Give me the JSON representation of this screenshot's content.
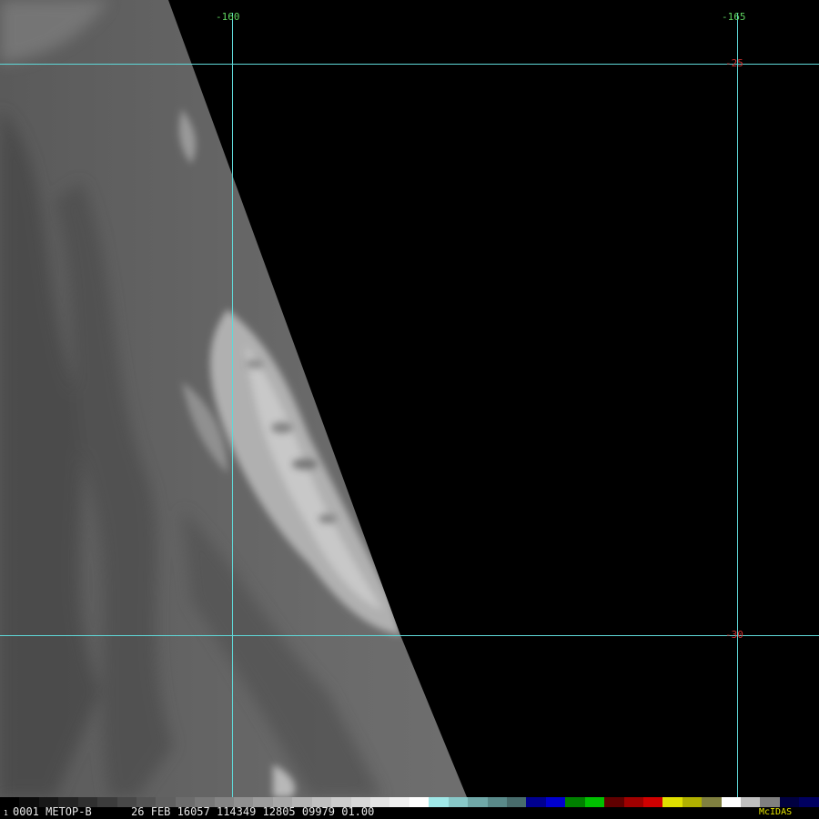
{
  "colors": {
    "background": "#000000",
    "gridline": "#5fd8d8",
    "lon_label": "#5ed15e",
    "lat_label": "#d03030",
    "caption": "#e8e8e8",
    "brand": "#e6e600"
  },
  "grid": {
    "longitude_labels": [
      "-160",
      "-165"
    ],
    "latitude_labels": [
      "-25",
      "-30"
    ]
  },
  "footer": {
    "frame_small": "1",
    "caption": "0001 METOP-B      26 FEB 16057 114349 12805 09979 01.00",
    "brand": "McIDAS"
  },
  "colorbar": {
    "segments": [
      "#000000",
      "#0c0c0c",
      "#181818",
      "#242424",
      "#303030",
      "#3c3c3c",
      "#484848",
      "#545454",
      "#606060",
      "#6c6c6c",
      "#787878",
      "#848484",
      "#909090",
      "#9c9c9c",
      "#a8a8a8",
      "#b4b4b4",
      "#c0c0c0",
      "#cccccc",
      "#d8d8d8",
      "#e4e4e4",
      "#f0f0f0",
      "#ffffff",
      "#a0e8e8",
      "#88c8c8",
      "#70a8a8",
      "#5a8a8a",
      "#486c6c",
      "#000090",
      "#0000d0",
      "#008000",
      "#00c000",
      "#600000",
      "#a00000",
      "#d00000",
      "#e0e000",
      "#b0b000",
      "#808040",
      "#ffffff",
      "#c0c0c0",
      "#808080",
      "#000040",
      "#000060"
    ]
  }
}
